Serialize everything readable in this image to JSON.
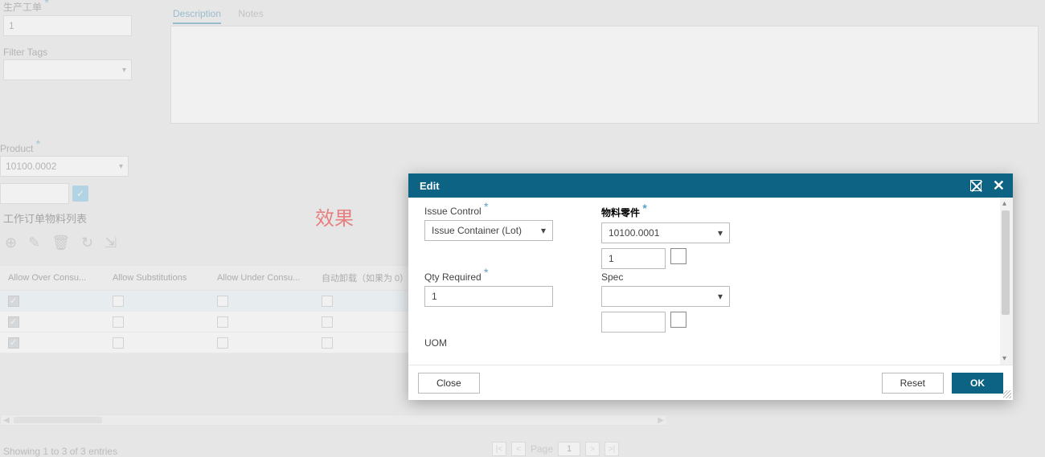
{
  "left_form": {
    "production_order": {
      "label": "生产工单",
      "value": "1"
    },
    "filter_tags": {
      "label": "Filter Tags",
      "value": ""
    },
    "product": {
      "label": "Product",
      "value": "10100.0002"
    },
    "aux_input": "",
    "aux_checked": true
  },
  "tabs": {
    "description": "Description",
    "notes": "Notes"
  },
  "section_title": "工作订单物料列表",
  "red_label": "效果",
  "table": {
    "headers": {
      "c0": "Allow Over Consu...",
      "c1": "Allow Substitutions",
      "c2": "Allow Under Consu...",
      "c3": "自动卸载（如果为 0）"
    },
    "rows": [
      {
        "c0": true,
        "c1": false,
        "c2": false,
        "c3": false
      },
      {
        "c0": true,
        "c1": false,
        "c2": false,
        "c3": false
      },
      {
        "c0": true,
        "c1": false,
        "c2": false,
        "c3": false
      }
    ]
  },
  "footer_text": "Showing 1 to 3 of 3 entries",
  "pager": {
    "label": "Page",
    "value": "1"
  },
  "modal": {
    "title": "Edit",
    "issue_control": {
      "label": "Issue Control",
      "value": "Issue Container (Lot)"
    },
    "material": {
      "label": "物料零件",
      "value": "10100.0001",
      "sub_value": "1"
    },
    "qty_required": {
      "label": "Qty Required",
      "value": "1"
    },
    "spec": {
      "label": "Spec",
      "value": "",
      "sub_value": ""
    },
    "uom_label": "UOM",
    "buttons": {
      "close": "Close",
      "reset": "Reset",
      "ok": "OK"
    }
  }
}
